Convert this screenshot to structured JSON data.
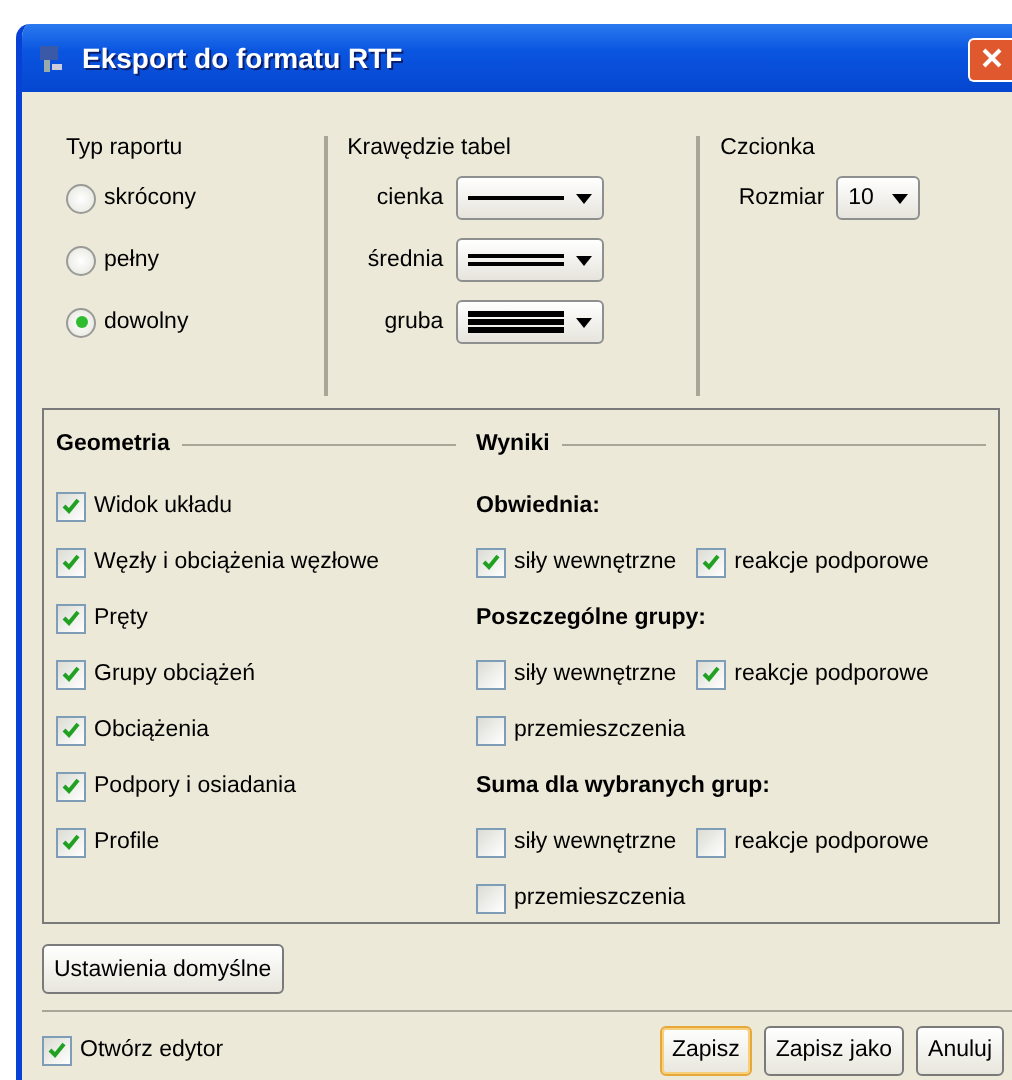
{
  "window": {
    "title": "Eksport do formatu RTF"
  },
  "report_type": {
    "label": "Typ raportu",
    "options": [
      {
        "label": "skrócony",
        "selected": false
      },
      {
        "label": "pełny",
        "selected": false
      },
      {
        "label": "dowolny",
        "selected": true
      }
    ]
  },
  "table_borders": {
    "label": "Krawędzie tabel",
    "rows": [
      {
        "label": "cienka",
        "kind": "single"
      },
      {
        "label": "średnia",
        "kind": "double"
      },
      {
        "label": "gruba",
        "kind": "triple"
      }
    ]
  },
  "font": {
    "label": "Czcionka",
    "size_label": "Rozmiar",
    "size": "10"
  },
  "geometry": {
    "title": "Geometria",
    "items": [
      {
        "label": "Widok układu",
        "checked": true
      },
      {
        "label": "Węzły i obciążenia węzłowe",
        "checked": true
      },
      {
        "label": "Pręty",
        "checked": true
      },
      {
        "label": "Grupy obciążeń",
        "checked": true
      },
      {
        "label": "Obciążenia",
        "checked": true
      },
      {
        "label": "Podpory i osiadania",
        "checked": true
      },
      {
        "label": "Profile",
        "checked": true
      }
    ]
  },
  "results": {
    "title": "Wyniki",
    "groups": [
      {
        "title": "Obwiednia:",
        "items": [
          {
            "label": "siły wewnętrzne",
            "checked": true
          },
          {
            "label": "reakcje podporowe",
            "checked": true
          }
        ]
      },
      {
        "title": "Poszczególne grupy:",
        "items": [
          {
            "label": "siły wewnętrzne",
            "checked": false
          },
          {
            "label": "reakcje podporowe",
            "checked": true
          },
          {
            "label": "przemieszczenia",
            "checked": false
          }
        ]
      },
      {
        "title": "Suma dla wybranych grup:",
        "items": [
          {
            "label": "siły wewnętrzne",
            "checked": false
          },
          {
            "label": "reakcje podporowe",
            "checked": false
          },
          {
            "label": "przemieszczenia",
            "checked": false
          }
        ]
      }
    ]
  },
  "defaults_button": "Ustawienia domyślne",
  "open_editor": {
    "label": "Otwórz edytor",
    "checked": true
  },
  "buttons": [
    {
      "label": "Zapisz",
      "default": true
    },
    {
      "label": "Zapisz jako",
      "default": false
    },
    {
      "label": "Anuluj",
      "default": false
    }
  ]
}
